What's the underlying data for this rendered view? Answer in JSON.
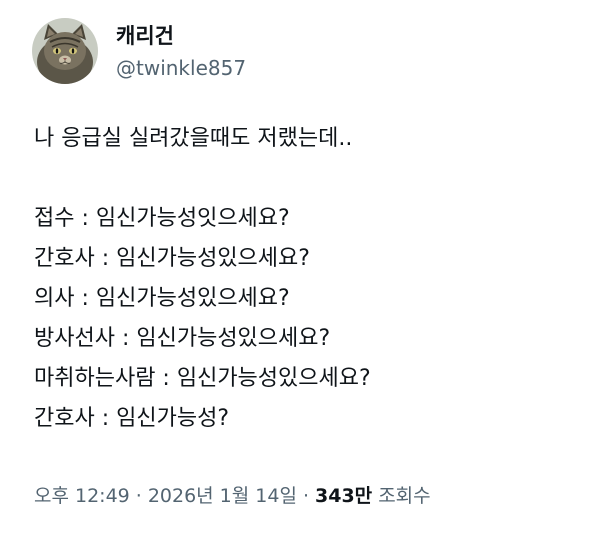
{
  "author": {
    "display_name": "캐리건",
    "handle": "@twinkle857"
  },
  "tweet": {
    "lines": [
      "나 응급실 실려갔을때도 저랬는데..",
      "",
      "접수 : 임신가능성잇으세요?",
      "간호사 : 임신가능성있으세요?",
      "의사 : 임신가능성있으세요?",
      "방사선사 : 임신가능성있으세요?",
      "마취하는사람 : 임신가능성있으세요?",
      "간호사 : 임신가능성?"
    ]
  },
  "meta": {
    "time": "오후 12:49",
    "separator": "·",
    "date": "2026년 1월 14일",
    "views_count": "343만",
    "views_label": "조회수"
  },
  "colors": {
    "text": "#0f1419",
    "secondary": "#536471",
    "background": "#ffffff"
  }
}
